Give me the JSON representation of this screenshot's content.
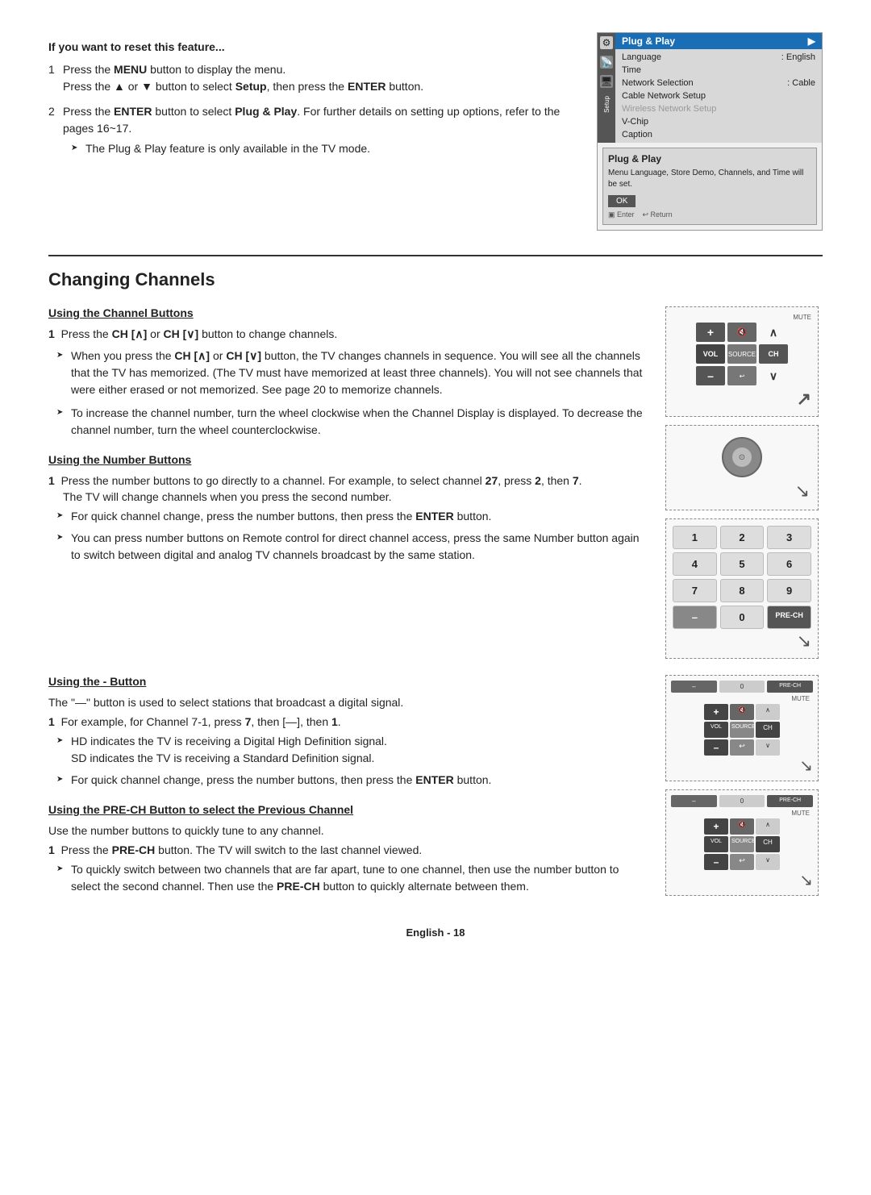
{
  "top_section": {
    "heading": "If you want to reset this feature...",
    "steps": [
      {
        "num": "1",
        "text_parts": [
          {
            "text": "Press the ",
            "bold": false
          },
          {
            "text": "MENU",
            "bold": true
          },
          {
            "text": " button to display the menu.",
            "bold": false
          }
        ],
        "subtext": [
          {
            "text": "Press the ▲ or ▼ button to select ",
            "bold": false
          },
          {
            "text": "Setup",
            "bold": true
          },
          {
            "text": ", then press the ",
            "bold": false
          },
          {
            "text": "ENTER",
            "bold": true
          },
          {
            "text": " button.",
            "bold": false
          }
        ]
      },
      {
        "num": "2",
        "text_parts": [
          {
            "text": "Press the ",
            "bold": false
          },
          {
            "text": "ENTER",
            "bold": true
          },
          {
            "text": " button to select ",
            "bold": false
          },
          {
            "text": "Plug & Play",
            "bold": true
          },
          {
            "text": ". For further details on setting up options, refer to the pages 16~17.",
            "bold": false
          }
        ],
        "arrow_text": "The Plug & Play feature is only available in the TV mode."
      }
    ]
  },
  "tv_menu": {
    "sidebar_label": "Setup",
    "menu_title": "Plug & Play",
    "menu_items": [
      {
        "label": "Language",
        "value": ": English",
        "greyed": false
      },
      {
        "label": "Time",
        "value": "",
        "greyed": false
      },
      {
        "label": "Network Selection",
        "value": ": Cable",
        "greyed": false
      },
      {
        "label": "Cable Network Setup",
        "value": "",
        "greyed": false
      },
      {
        "label": "Wireless Network Setup",
        "value": "",
        "greyed": true
      },
      {
        "label": "V-Chip",
        "value": "",
        "greyed": false
      },
      {
        "label": "Caption",
        "value": "",
        "greyed": false
      }
    ],
    "dialog": {
      "title": "Plug & Play",
      "text": "Menu Language, Store Demo, Channels, and Time will be set.",
      "ok_btn": "OK",
      "footer_enter": "▣ Enter",
      "footer_return": "↩ Return"
    }
  },
  "section_title": "Changing Channels",
  "subsections": [
    {
      "title": "Using the Channel Buttons",
      "step1_text": "Press the CH [∧] or CH [∨] button to change channels.",
      "bullets": [
        "When you press the CH [∧] or CH [∨] button, the TV changes channels in sequence. You will see all the channels that the TV has memorized. (The TV must have memorized at least three channels). You will not see channels that were either erased or not memorized. See page 20 to memorize channels.",
        "To increase the channel number, turn the wheel clockwise when the Channel Display is displayed. To decrease the channel number, turn the wheel counterclockwise."
      ]
    },
    {
      "title": "Using the Number Buttons",
      "step1_text_parts": [
        {
          "text": "Press the number buttons to go directly to a channel. For example, to select channel ",
          "bold": false
        },
        {
          "text": "27",
          "bold": true
        },
        {
          "text": ", press ",
          "bold": false
        },
        {
          "text": "2",
          "bold": true
        },
        {
          "text": ", then ",
          "bold": false
        },
        {
          "text": "7",
          "bold": true
        },
        {
          "text": ".",
          "bold": false
        }
      ],
      "step1_sub": "The TV will change channels when you press the second number.",
      "bullets": [
        "For quick channel change, press the number buttons, then press the ENTER button.",
        "You can press number buttons on Remote control for direct channel access, press the same Number button again to switch between digital and analog TV channels broadcast by the same station."
      ]
    },
    {
      "title": "Using the - Button",
      "intro": "The \"—\" button is used to select stations that broadcast a digital signal.",
      "step1_text_parts": [
        {
          "text": "For example, for Channel 7-1, press ",
          "bold": false
        },
        {
          "text": "7",
          "bold": true
        },
        {
          "text": ", then [—], then ",
          "bold": false
        },
        {
          "text": "1",
          "bold": true
        },
        {
          "text": ".",
          "bold": false
        }
      ],
      "bullets": [
        "HD indicates the TV is receiving a Digital High Definition signal. SD indicates the TV is receiving a Standard Definition signal.",
        "For quick channel change, press the number buttons, then press the ENTER button."
      ]
    },
    {
      "title": "Using the PRE-CH Button to select the Previous Channel",
      "intro": "Use the number buttons to quickly tune to any channel.",
      "step1_text_parts": [
        {
          "text": "Press the ",
          "bold": false
        },
        {
          "text": "PRE-CH",
          "bold": true
        },
        {
          "text": " button. The TV will switch to the last channel viewed.",
          "bold": false
        }
      ],
      "bullets": [
        "To quickly switch between two channels that are far apart, tune to one channel, then use the number button to select the second channel. Then use the PRE-CH button to quickly alternate between them."
      ]
    }
  ],
  "footer": {
    "text": "English - 18"
  },
  "remote_labels": {
    "mute": "MUTE",
    "vol": "VOL",
    "source": "SOURCE",
    "ch": "CH",
    "plus": "+",
    "minus": "–",
    "return_sym": "↩",
    "enter_sym": "▣",
    "prech": "PRE-CH",
    "zero": "0"
  }
}
